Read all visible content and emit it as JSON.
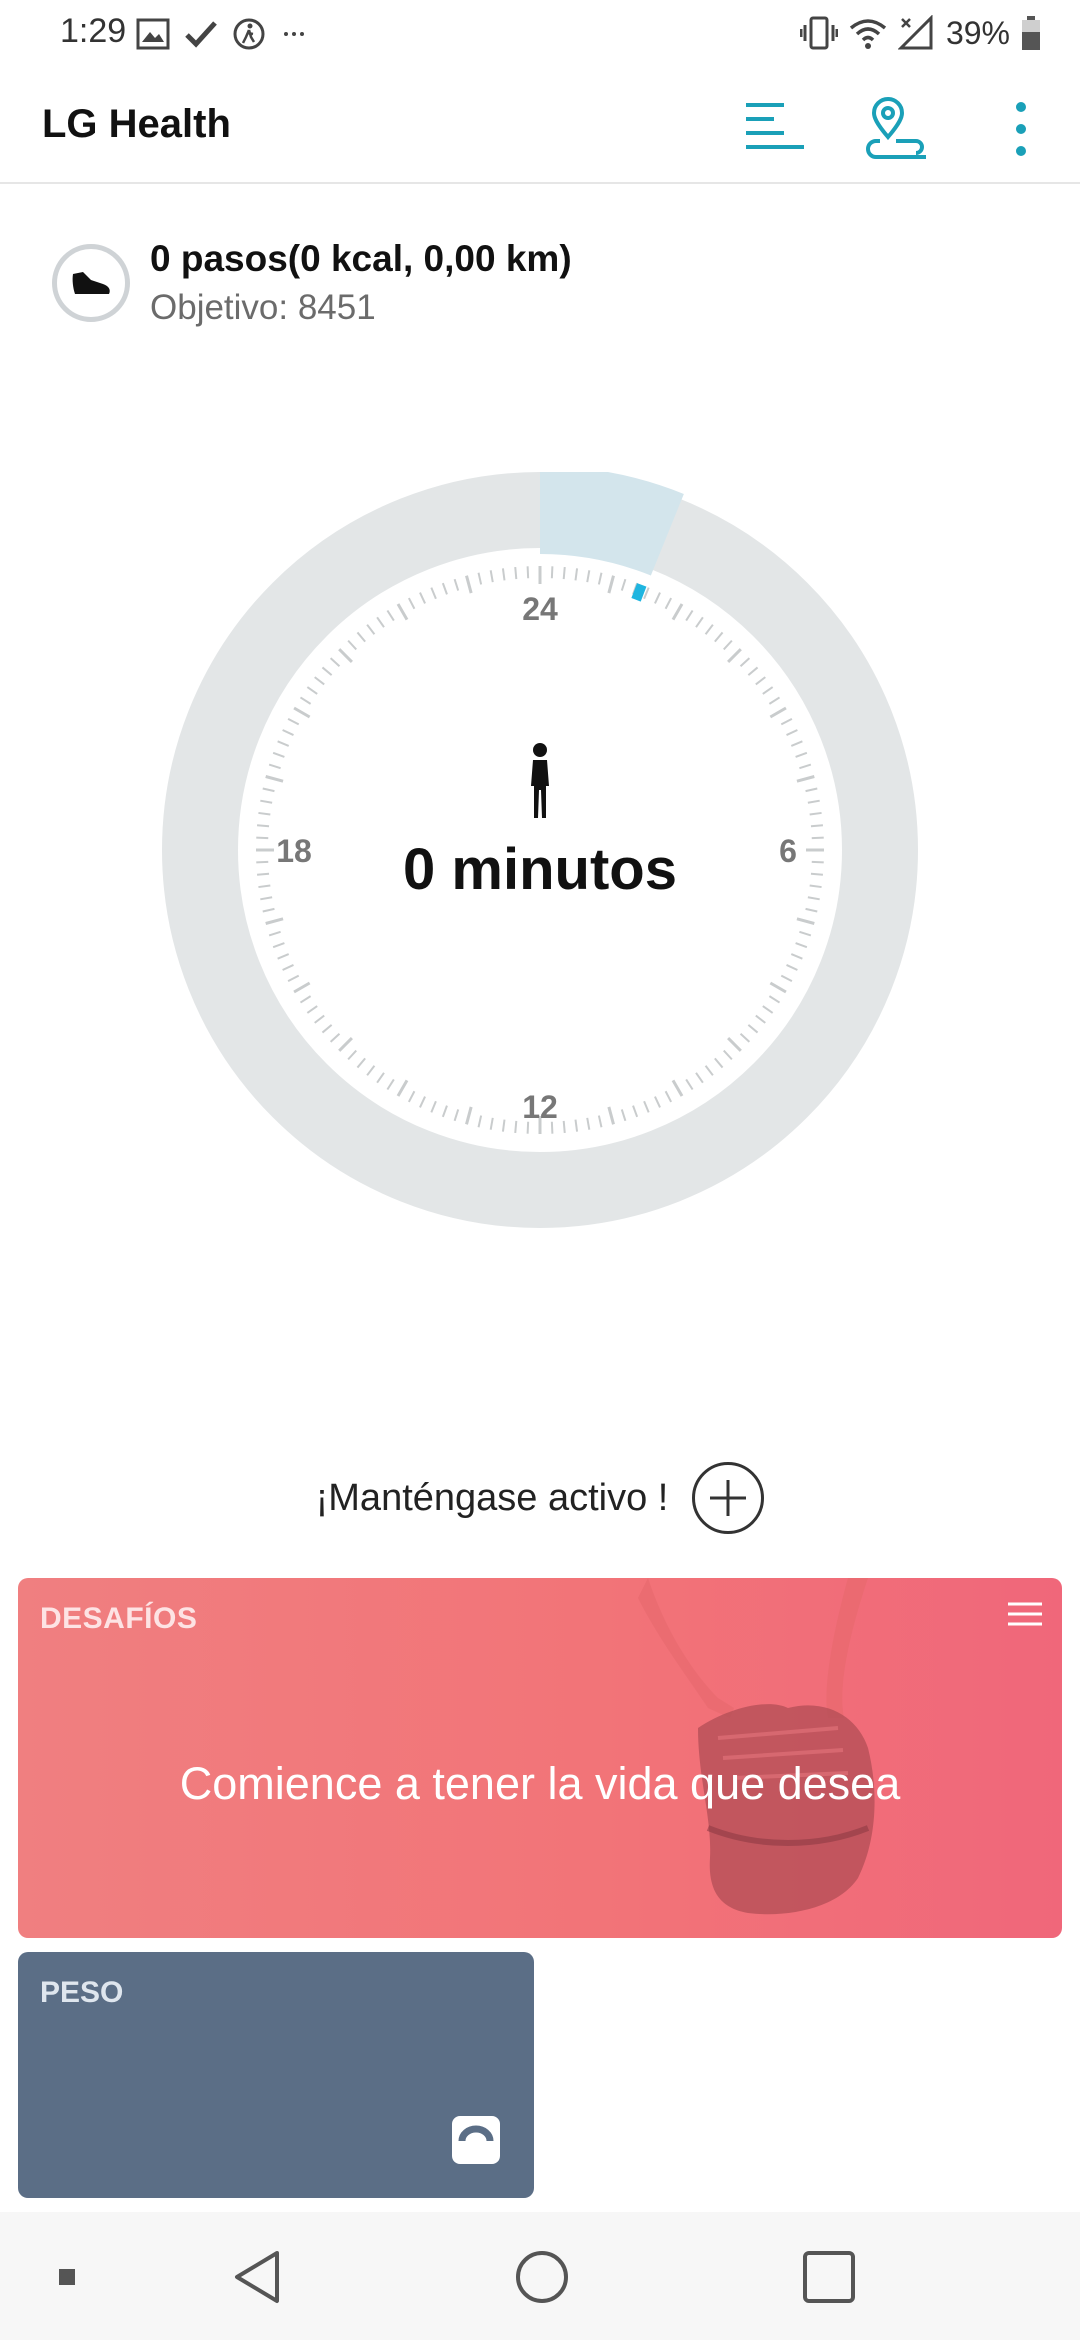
{
  "status_bar": {
    "time": "1:29",
    "battery": "39%",
    "icons_left": [
      "image-icon",
      "check-icon",
      "walk-icon",
      "more-dots-icon"
    ],
    "icons_right": [
      "vibrate-icon",
      "wifi-icon",
      "signal-icon",
      "battery-icon"
    ]
  },
  "app_bar": {
    "title": "LG Health",
    "icons": [
      "list-icon",
      "location-icon",
      "overflow-menu-icon"
    ],
    "accent_color": "#1aa0b8"
  },
  "steps": {
    "summary": "0 pasos(0 kcal, 0,00 km)",
    "goal": "Objetivo: 8451"
  },
  "dial": {
    "labels": {
      "top": "24",
      "right": "6",
      "bottom": "12",
      "left": "18"
    },
    "value": "0 minutos",
    "ring_color": "#e3e6e7",
    "highlight_color": "#d3e5ec",
    "marker_color": "#1fb5e0"
  },
  "keep_active": {
    "text": "¡Manténgase activo !"
  },
  "challenges_card": {
    "title": "DESAFÍOS",
    "text": "Comience a tener la vida que desea"
  },
  "weight_card": {
    "title": "PESO"
  },
  "nav_bar": {
    "icons": [
      "dot-icon",
      "back-icon",
      "home-icon",
      "recents-icon"
    ]
  }
}
